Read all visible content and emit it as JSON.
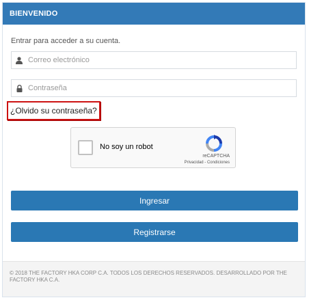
{
  "panel": {
    "title": "BIENVENIDO",
    "intro": "Entrar para acceder a su cuenta."
  },
  "form": {
    "email": {
      "placeholder": "Correo electrónico",
      "icon": "user-icon"
    },
    "password": {
      "placeholder": "Contraseña",
      "icon": "lock-icon"
    },
    "forgot_link": "¿Olvido su contraseña?"
  },
  "recaptcha": {
    "checkbox_label": "No soy un robot",
    "brand": "reCAPTCHA",
    "links": "Privacidad - Condiciones"
  },
  "buttons": {
    "login": "Ingresar",
    "register": "Registrarse"
  },
  "footer": {
    "text": "© 2018 THE FACTORY HKA CORP C.A. TODOS LOS DERECHOS RESERVADOS. DESARROLLADO POR THE FACTORY HKA C.A."
  },
  "colors": {
    "header": "#337ab7",
    "button": "#2a78b4",
    "highlight_border": "#cc1111"
  }
}
